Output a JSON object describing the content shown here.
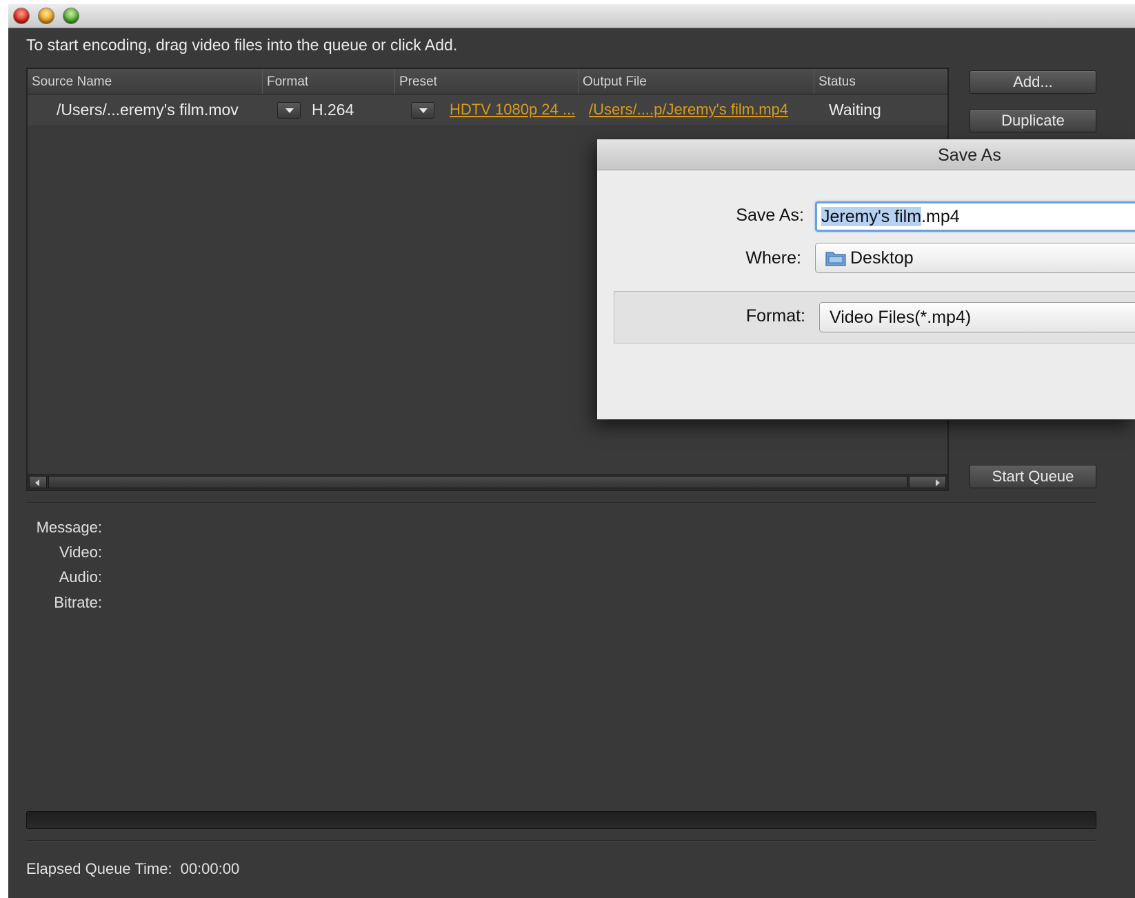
{
  "instruction": "To start encoding, drag video files into the queue or click Add.",
  "queue": {
    "columns": [
      "Source Name",
      "Format",
      "Preset",
      "Output File",
      "Status"
    ],
    "rows": [
      {
        "source": "/Users/...eremy's film.mov",
        "format": "H.264",
        "preset": "HDTV 1080p 24 ...",
        "output": "/Users/....p/Jeremy's film.mp4",
        "status": "Waiting"
      }
    ]
  },
  "buttons": {
    "add": "Add...",
    "duplicate": "Duplicate",
    "start_queue": "Start Queue"
  },
  "info": {
    "message_label": "Message:",
    "video_label": "Video:",
    "audio_label": "Audio:",
    "bitrate_label": "Bitrate:"
  },
  "progress": {
    "value": 0
  },
  "elapsed": {
    "label": "Elapsed Queue Time:",
    "value": "00:00:00"
  },
  "save_dialog": {
    "title": "Save As",
    "save_as_label": "Save As:",
    "filename_selected": "Jeremy's film",
    "filename_ext": ".mp4",
    "where_label": "Where:",
    "where_value": "Desktop",
    "format_label": "Format:",
    "format_value": "Video Files(*.mp4)"
  },
  "colors": {
    "window_bg": "#393939",
    "accent_orange": "#d99a1a",
    "selection_blue": "#b5d2f3"
  }
}
